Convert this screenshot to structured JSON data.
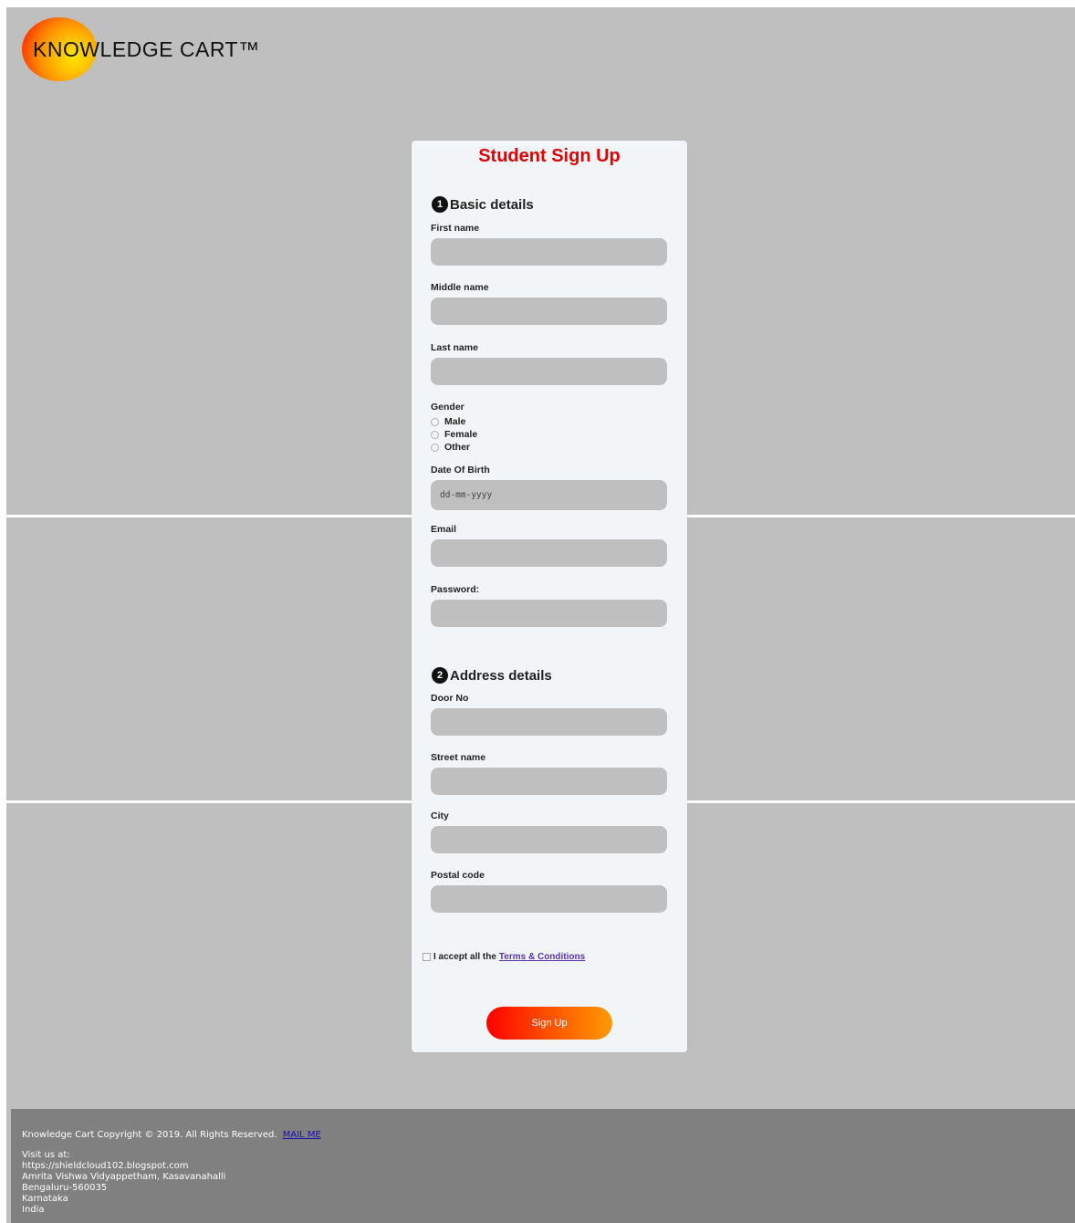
{
  "brand": {
    "logo_text": "KNOWLEDGE CART™"
  },
  "form": {
    "title": "Student Sign Up",
    "basic": {
      "step": "1",
      "title": "Basic details",
      "first_name_label": "First name",
      "middle_name_label": "Middle name",
      "last_name_label": "Last name",
      "gender_label": "Gender",
      "gender_options": [
        "Male",
        "Female",
        "Other"
      ],
      "dob_label": "Date Of Birth",
      "dob_placeholder": "dd-mm-yyyy",
      "email_label": "Email",
      "password_label": "Password:"
    },
    "address": {
      "step": "2",
      "title": "Address details",
      "door_label": "Door No",
      "street_label": "Street name",
      "city_label": "City",
      "postal_label": "Postal code"
    },
    "terms": {
      "text": "I accept all the",
      "link": "Terms & Conditions"
    },
    "submit_label": "Sign Up"
  },
  "footer": {
    "copyright": "Knowledge Cart Copyright © 2019. All Rights Reserved.",
    "mail_link": "MAIL ME",
    "visit_lines": [
      "Visit us at:",
      "https://shieldcloud102.blogspot.com",
      "Amrita Vishwa Vidyappetham, Kasavanahalli",
      "Bengaluru-560035",
      "Karnataka",
      "India"
    ]
  },
  "colors": {
    "page_bg": "#bfbfbf",
    "card_bg": "#f1f5f7",
    "title_red": "#e00000",
    "footer_bg": "#808080"
  }
}
